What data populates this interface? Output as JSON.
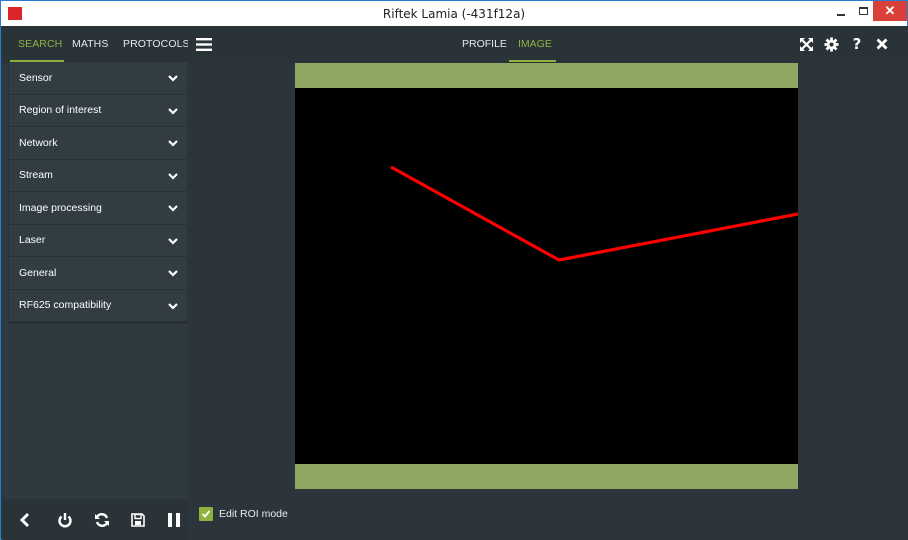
{
  "window": {
    "title": "Riftek Lamia (-431f12a)",
    "close_glyph": "✕"
  },
  "left_tabs": [
    {
      "label": "SEARCH",
      "active": true
    },
    {
      "label": "MATHS",
      "active": false
    },
    {
      "label": "PROTOCOLS",
      "active": false
    }
  ],
  "settings_sections": [
    {
      "label": "Sensor"
    },
    {
      "label": "Region of interest"
    },
    {
      "label": "Network"
    },
    {
      "label": "Stream"
    },
    {
      "label": "Image processing"
    },
    {
      "label": "Laser"
    },
    {
      "label": "General"
    },
    {
      "label": "RF625 compatibility"
    }
  ],
  "bottom_toolbar": [
    "back-icon",
    "power-icon",
    "refresh-icon",
    "save-icon",
    "pause-icon"
  ],
  "main_tabs": [
    {
      "label": "PROFILE",
      "active": false
    },
    {
      "label": "IMAGE",
      "active": true
    }
  ],
  "header_icons": [
    "fullscreen-icon",
    "gear-icon",
    "help-icon",
    "close-icon"
  ],
  "header_help_glyph": "?",
  "footer": {
    "edit_roi_label": "Edit ROI mode",
    "edit_roi_checked": true
  },
  "colors": {
    "accent": "#8fb23f",
    "roi_band": "#8ea762",
    "laser_line": "#ff0000",
    "panel_dark": "#2a3338",
    "panel": "#323d43"
  }
}
